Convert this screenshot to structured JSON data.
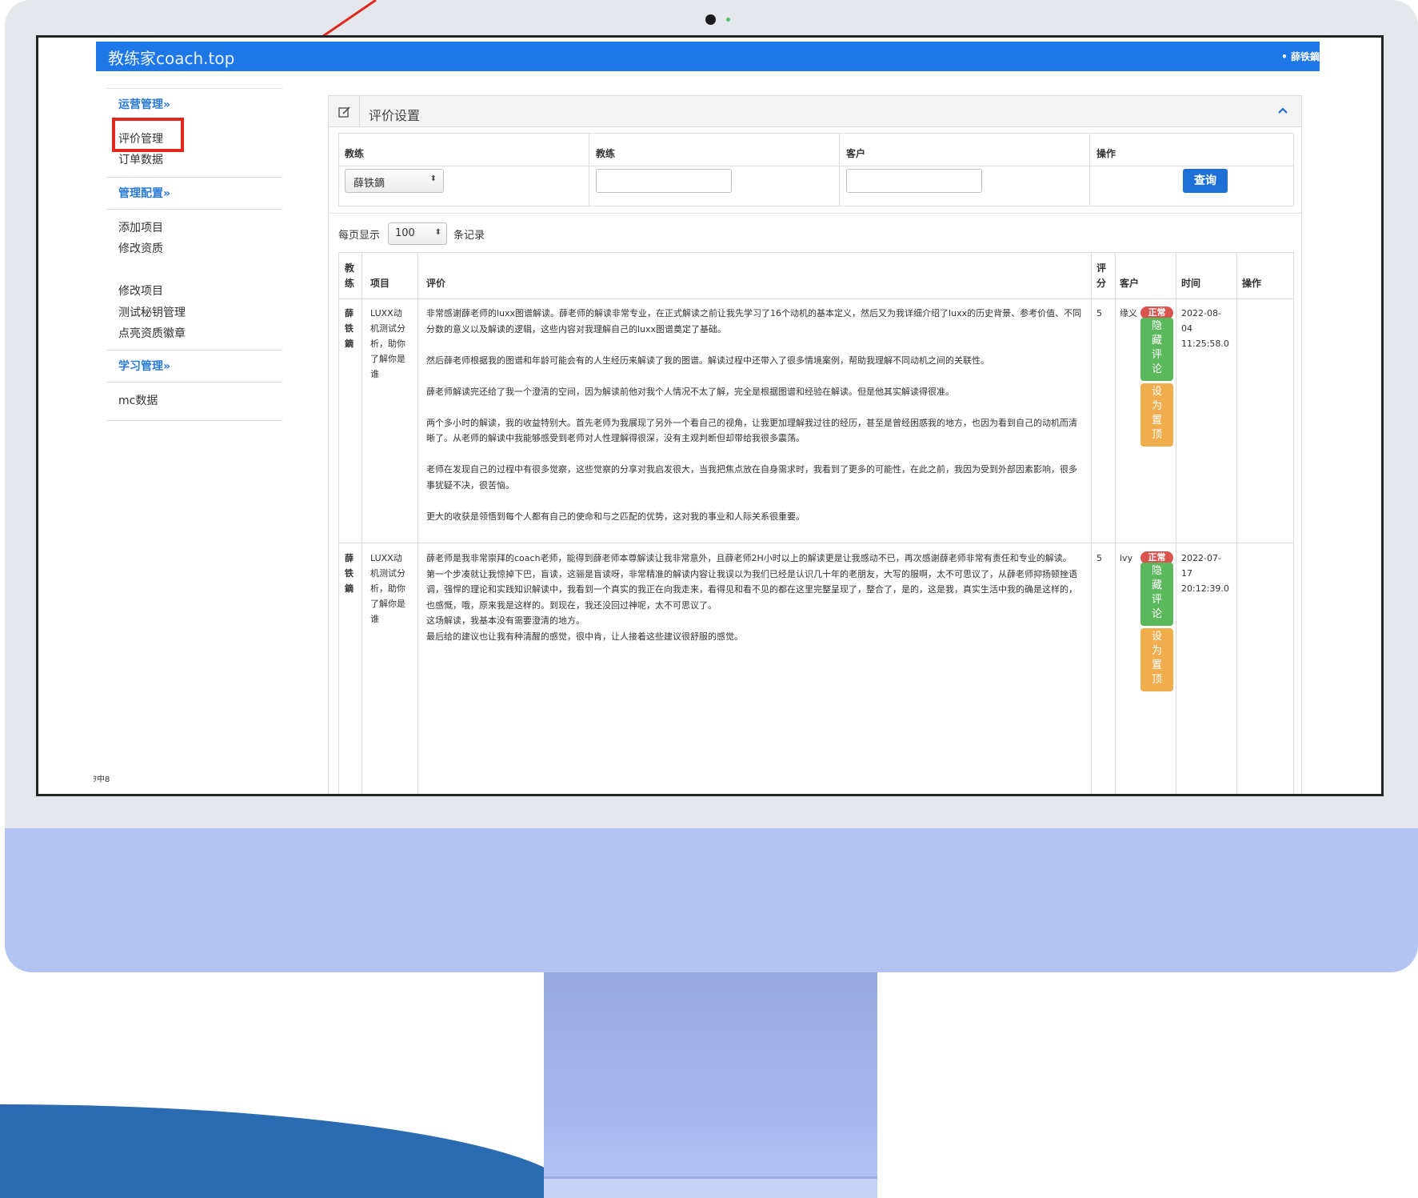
{
  "app": {
    "brand": "教练家coach.top",
    "user": "• 薛铁鏑"
  },
  "sidebar": {
    "sections": [
      {
        "header": "运营管理»",
        "items": [
          "评价管理",
          "订单数据"
        ]
      },
      {
        "header": "管理配置»",
        "items": [
          "添加项目",
          "修改资质",
          "修改项目",
          "测试秘钥管理",
          "点亮资质徽章"
        ]
      },
      {
        "header": "学习管理»",
        "items": [
          "mc数据"
        ]
      }
    ],
    "selected": "评价管理"
  },
  "footer": "ｦ中8",
  "panel": {
    "title": "评价设置"
  },
  "filters": {
    "headers": [
      "教练",
      "教练",
      "客户",
      "操作"
    ],
    "coach_select": "薛铁鏑",
    "query_button": "查询"
  },
  "paging": {
    "prefix": "每页显示",
    "value": "100",
    "suffix": "条记录"
  },
  "table": {
    "headers": {
      "coach": "教\n练",
      "project": "项目",
      "review": "评价",
      "score": "评\n分",
      "customer": "客户",
      "time": "时间",
      "action": "操作"
    },
    "rows": [
      {
        "coach": "薛\n铁\n鏑",
        "project": "LUXX动\n机测试分\n析，助你\n了解你是\n谁",
        "review": "非常感谢薛老师的luxx图谱解读。薛老师的解读非常专业，在正式解读之前让我先学习了16个动机的基本定义，然后又为我详细介绍了luxx的历史背景、参考价值、不同分数的意义以及解读的逻辑，这些内容对我理解自己的luxx图谱奠定了基础。\n\n然后薛老师根据我的图谱和年龄可能会有的人生经历来解读了我的图谱。解读过程中还带入了很多情境案例，帮助我理解不同动机之间的关联性。\n\n薛老师解读完还给了我一个澄清的空间，因为解读前他对我个人情况不太了解，完全是根据图谱和经验在解读。但是他其实解读得很准。\n\n两个多小时的解读，我的收益特别大。首先老师为我展现了另外一个看自己的视角，让我更加理解我过往的经历，甚至是曾经困惑我的地方，也因为看到自己的动机而清晰了。从老师的解读中我能够感受到老师对人性理解得很深，没有主观判断但却带给我很多震荡。\n\n老师在发现自己的过程中有很多觉察，这些觉察的分享对我启发很大，当我把焦点放在自身需求时，我看到了更多的可能性，在此之前，我因为受到外部因素影响，很多事犹疑不决，很苦恼。\n\n更大的收获是领悟到每个人都有自己的使命和与之匹配的优势，这对我的事业和人际关系很重要。",
        "score": "5",
        "customer": "缘义",
        "time": "2022-08-\n04\n11:25:58.0",
        "status": "正常",
        "hide": "隐\n藏\n评\n论",
        "pin": "设\n为\n置\n顶"
      },
      {
        "coach": "薛\n铁\n鏑",
        "project": "LUXX动\n机测试分\n析，助你\n了解你是\n谁",
        "review": "薛老师是我非常崇拜的coach老师，能得到薛老师本尊解读让我非常意外，且薛老师2H小时以上的解读更是让我感动不已，再次感谢薛老师非常有责任和专业的解读。\n第一个步凑就让我惊掉下巴，盲读，这骊是盲读呀，非常精准的解读内容让我误以为我们已经是认识几十年的老朋友，大写的服啊，太不可思议了，从薛老师抑扬顿挫语调，强悍的理论和实践知识解读中，我看到一个真实的我正在向我走来，看得见和看不见的都在这里完整呈现了，整合了，是的，这是我，真实生活中我的确是这样的，也感慨，哦，原来我是这样的。到现在，我还没回过神呢，太不可思议了。\n这场解读，我基本没有需要澄清的地方。\n最后给的建议也让我有种清醒的感觉，很中肯，让人接着这些建议很舒服的感觉。",
        "score": "5",
        "customer": "ivy",
        "time": "2022-07-\n17\n20:12:39.0",
        "status": "正常",
        "hide": "隐\n藏\n评\n论",
        "pin": "设\n为\n置\n顶"
      }
    ]
  },
  "colors": {
    "brand_bar": "#1e77e7",
    "accent": "#e0281e",
    "imac_chin": "#b3c4f2"
  }
}
